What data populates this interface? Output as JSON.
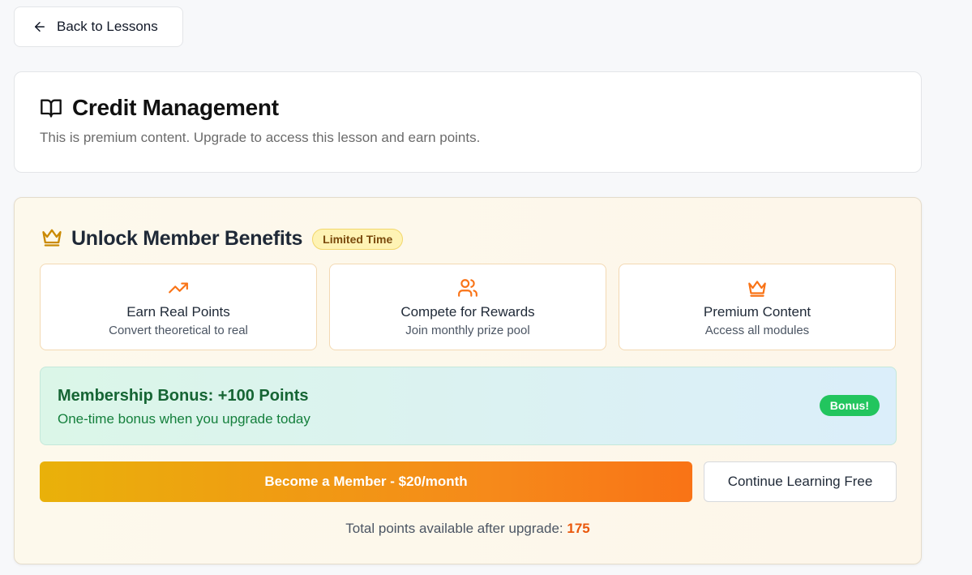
{
  "back_button": {
    "label": "Back to Lessons",
    "icon": "arrow-left-icon"
  },
  "lesson": {
    "icon": "book-open-icon",
    "title": "Credit Management",
    "subtitle": "This is premium content. Upgrade to access this lesson and earn points."
  },
  "benefits": {
    "icon": "crown-icon",
    "title": "Unlock Member Benefits",
    "badge": "Limited Time",
    "features": [
      {
        "icon": "trending-up-icon",
        "title": "Earn Real Points",
        "description": "Convert theoretical to real"
      },
      {
        "icon": "users-icon",
        "title": "Compete for Rewards",
        "description": "Join monthly prize pool"
      },
      {
        "icon": "crown-icon",
        "title": "Premium Content",
        "description": "Access all modules"
      }
    ],
    "bonus": {
      "title": "Membership Bonus: +100 Points",
      "description": "One-time bonus when you upgrade today",
      "pill": "Bonus!"
    },
    "cta_label": "Become a Member - $20/month",
    "free_label": "Continue Learning Free",
    "total_label": "Total points available after upgrade:",
    "total_points": "175"
  },
  "colors": {
    "accent_orange": "#f97316",
    "accent_gold": "#eab308",
    "bonus_green": "#22c55e",
    "badge_yellow": "#fef3b4"
  }
}
